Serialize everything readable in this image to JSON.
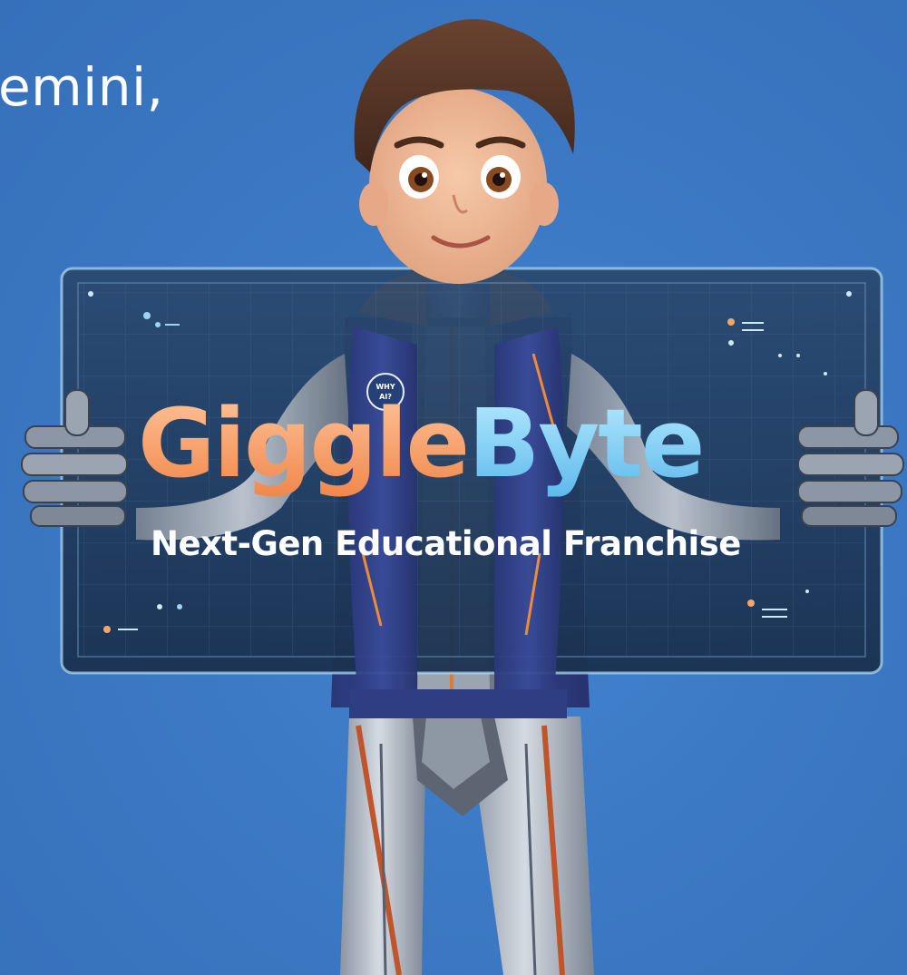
{
  "slide": {
    "partial_caption": "emini,"
  },
  "banner": {
    "title_part1": "Giggle",
    "title_part2": "Byte",
    "subtitle": "Next-Gen Educational Franchise"
  },
  "badge": {
    "line1": "WHY",
    "line2": "AI?"
  },
  "colors": {
    "background": "#3d7ac6",
    "title_orange": "#f4a46a",
    "title_blue": "#86d4f2",
    "panel_glass": "#1c3757",
    "vest": "#2e3f85",
    "accent_orange": "#f08a3a"
  },
  "icons": [
    "robot-boy-illustration",
    "holographic-panel",
    "why-ai-badge"
  ]
}
